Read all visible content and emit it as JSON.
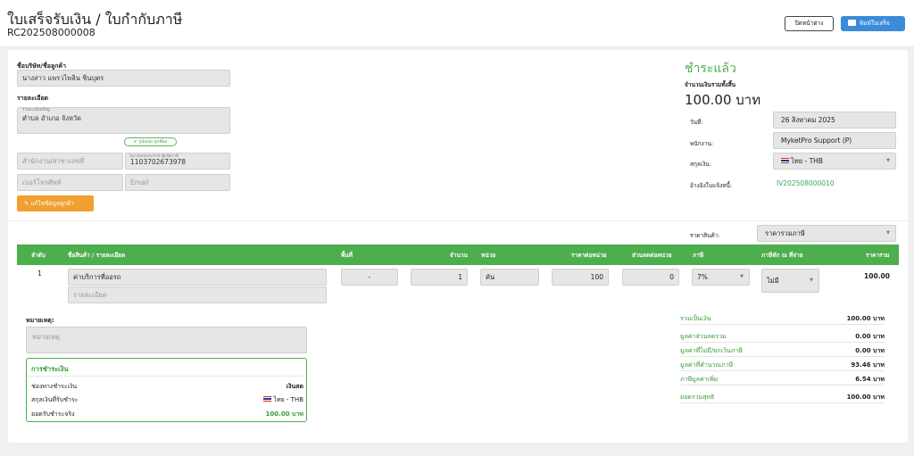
{
  "header": {
    "title": "ใบเสร็จรับเงิน / ใบกำกับภาษี",
    "doc_no": "RC202508000008",
    "close_btn": "ปิดหน้าต่าง",
    "print_btn": "พิมพ์ใบเสร็จ"
  },
  "customer": {
    "name_label": "ชื่อบริษัท/ชื่อลูกค้า",
    "name_value": "นางสาว แพรวไพลิน ชินบุตร",
    "detail_label": "รายละเอียด",
    "address_sublabel": "รายละเอียดที่อยู่",
    "address_value": "ตำบล อำเภอ จังหวัด",
    "verify_badge": "รูปแบบ ถูกต้อง",
    "branch_placeholder": "สำนักงาน/สาขาเลขที่",
    "tax_id_sublabel": "หมายเลขประจำตัวผู้เสียภาษี",
    "tax_id_value": "1103702673978",
    "phone_placeholder": "เบอร์โทรศัพท์",
    "email_placeholder": "Email",
    "edit_btn": "แก้ไขข้อมูลลูกค้า"
  },
  "summary_top": {
    "status": "ชำระแล้ว",
    "total_label": "จำนวนเงินรวมทั้งสิ้น",
    "total_value": "100.00 บาท",
    "date_label": "วันที่:",
    "date_value": "26 สิงหาคม 2025",
    "staff_label": "พนักงาน:",
    "staff_value": "MyketPro Support (P)",
    "currency_label": "สกุลเงิน:",
    "currency_value": "ไทย - THB",
    "ref_label": "อ้างอิงใบแจ้งหนี้:",
    "ref_value": "IV202508000010"
  },
  "price_type": {
    "label": "ราคาสินค้า:",
    "value": "ราคารวมภาษี"
  },
  "table": {
    "headers": [
      "ลำดับ",
      "ชื่อสินค้า / รายละเอียด",
      "พื้นที่",
      "จำนวน",
      "หน่วย",
      "ราคาต่อหน่วย",
      "ส่วนลดต่อหน่วย",
      "ภาษี",
      "ภาษีหัก ณ ที่จ่าย",
      "ราคารวม"
    ],
    "row": {
      "index": "1",
      "product": "ค่าบริการที่ออรถ",
      "detail_placeholder": "รายละเอียด",
      "area": "-",
      "qty": "1",
      "unit": "คัน",
      "unit_price": "100",
      "discount": "0",
      "vat": "7%",
      "wht": "ไม่มี",
      "total": "100.00"
    }
  },
  "remark": {
    "label": "หมายเหตุ:",
    "placeholder": "หมายเหตุ"
  },
  "payment": {
    "title": "การชำระเงิน",
    "channel_label": "ช่องทางชำระเงิน",
    "channel_value": "เงินสด",
    "currency_label": "สกุลเงินที่รับชำระ",
    "currency_value": "ไทย - THB",
    "amount_label": "ยอดรับชำระจริง",
    "amount_value": "100.00 บาท"
  },
  "totals": [
    {
      "label": "รวมเป็นเงิน",
      "value": "100.00 บาท"
    },
    {
      "label": "มูลค่าส่วนลดรวม",
      "value": "0.00 บาท"
    },
    {
      "label": "มูลค่าที่ไม่มี/ยกเว้นภาษี",
      "value": "0.00 บาท"
    },
    {
      "label": "มูลค่าที่คำนวณภาษี",
      "value": "93.46 บาท"
    },
    {
      "label": "ภาษีมูลค่าเพิ่ม",
      "value": "6.54 บาท"
    },
    {
      "label": "ยอดรวมสุทธิ",
      "value": "100.00 บาท"
    }
  ]
}
